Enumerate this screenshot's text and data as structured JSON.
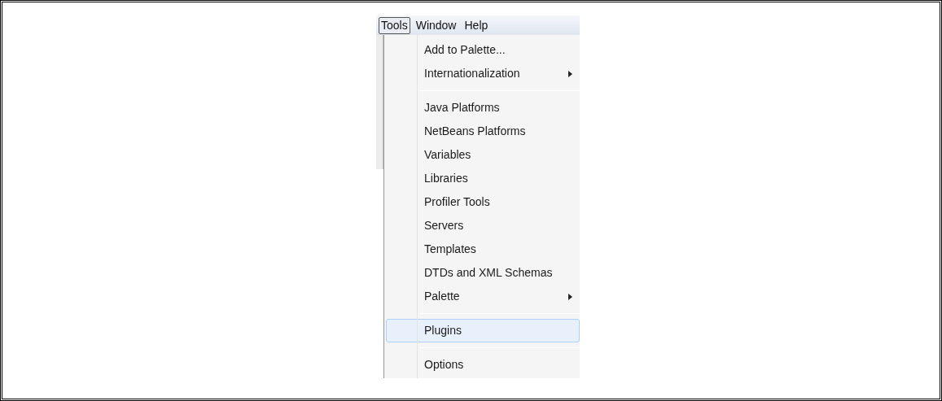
{
  "menubar": [
    {
      "label": "Tools",
      "selected": true
    },
    {
      "label": "Window",
      "selected": false
    },
    {
      "label": "Help",
      "selected": false
    }
  ],
  "menu": {
    "items": [
      {
        "kind": "item",
        "label": "Add to Palette...",
        "selected": false
      },
      {
        "kind": "submenu",
        "label": "Internationalization",
        "selected": false
      },
      {
        "kind": "separator"
      },
      {
        "kind": "item",
        "label": "Java Platforms",
        "selected": false
      },
      {
        "kind": "item",
        "label": "NetBeans Platforms",
        "selected": false
      },
      {
        "kind": "item",
        "label": "Variables",
        "selected": false
      },
      {
        "kind": "item",
        "label": "Libraries",
        "selected": false
      },
      {
        "kind": "item",
        "label": "Profiler Tools",
        "selected": false
      },
      {
        "kind": "item",
        "label": "Servers",
        "selected": false
      },
      {
        "kind": "item",
        "label": "Templates",
        "selected": false
      },
      {
        "kind": "item",
        "label": "DTDs and XML Schemas",
        "selected": false
      },
      {
        "kind": "submenu",
        "label": "Palette",
        "selected": false
      },
      {
        "kind": "separator"
      },
      {
        "kind": "item",
        "label": "Plugins",
        "selected": true
      },
      {
        "kind": "separator"
      },
      {
        "kind": "item",
        "label": "Options",
        "selected": false
      }
    ]
  }
}
